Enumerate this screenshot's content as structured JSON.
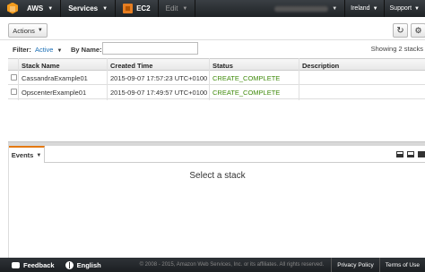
{
  "topnav": {
    "aws_label": "AWS",
    "services_label": "Services",
    "ec2_label": "EC2",
    "edit_label": "Edit",
    "region_label": "Ireland",
    "support_label": "Support"
  },
  "toolbar": {
    "actions_label": "Actions"
  },
  "filter": {
    "filter_label": "Filter:",
    "active_label": "Active",
    "byname_label": "By Name:",
    "byname_value": "",
    "showing": "Showing 2 stacks"
  },
  "table": {
    "columns": [
      "Stack Name",
      "Created Time",
      "Status",
      "Description"
    ],
    "rows": [
      {
        "name": "CassandraExample01",
        "created": "2015-09-07 17:57:23 UTC+0100",
        "status": "CREATE_COMPLETE",
        "description": ""
      },
      {
        "name": "OpscenterExample01",
        "created": "2015-09-07 17:49:57 UTC+0100",
        "status": "CREATE_COMPLETE",
        "description": ""
      }
    ]
  },
  "events": {
    "tab_label": "Events",
    "empty_message": "Select a stack"
  },
  "footer": {
    "feedback_label": "Feedback",
    "language_label": "English",
    "copyright": "© 2008 - 2015, Amazon Web Services, Inc. or its affiliates. All rights reserved.",
    "privacy_label": "Privacy Policy",
    "terms_label": "Terms of Use"
  },
  "colors": {
    "status_complete": "#3f8a0b",
    "link_blue": "#1a6eb5",
    "tab_accent": "#e47911"
  }
}
